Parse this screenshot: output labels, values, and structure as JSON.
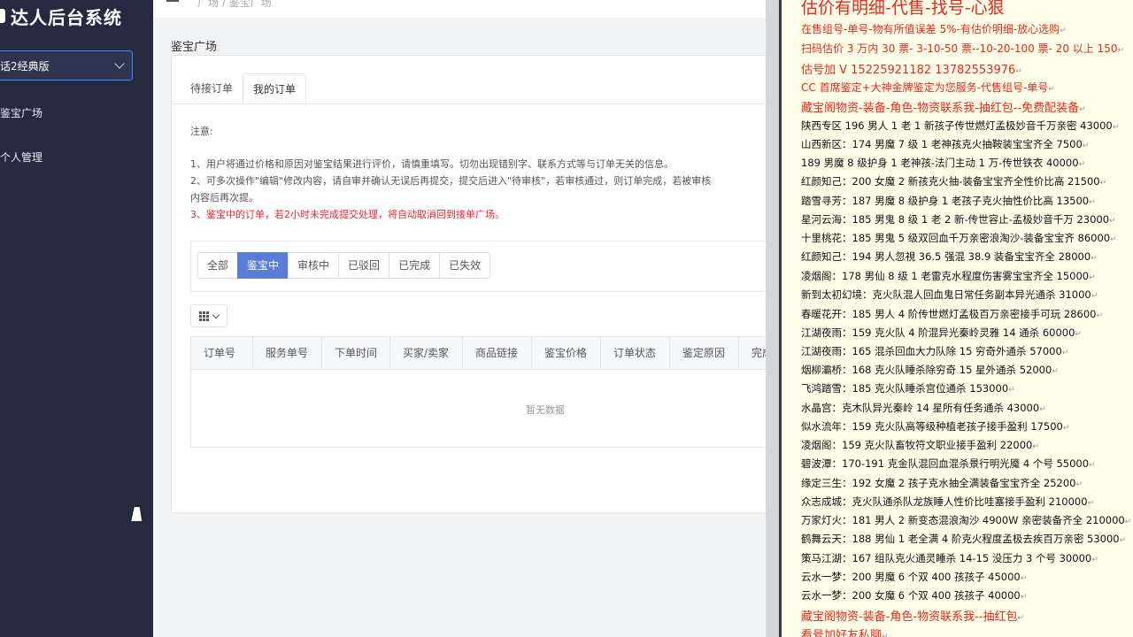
{
  "app": {
    "title": "达人后台系统"
  },
  "sidebar": {
    "game_select": "话2经典版",
    "items": [
      {
        "label": "鉴宝广场"
      },
      {
        "label": "个人管理"
      }
    ]
  },
  "header": {
    "breadcrumb": "广场 / 鉴宝广场"
  },
  "main": {
    "title": "鉴宝广场",
    "tabs": [
      {
        "label": "待接订单"
      },
      {
        "label": "我的订单"
      }
    ],
    "notice": {
      "heading": "注意:",
      "line1": "1、用户将通过价格和原因对鉴宝结果进行评价，请慎重填写。切勿出现错别字、联系方式等与订单无关的信息。",
      "line2a": "2、可多次操作\"编辑\"修改内容，请自审并确认无误后再提交，提交后进入\"待审核\"，若审核通过，则订单完成，若被审核",
      "line2b": "内容后再次提。",
      "line3": "3、鉴宝中的订单，若2小时未完成提交处理，将自动取消回到接单广场。"
    },
    "filters": [
      {
        "label": "全部"
      },
      {
        "label": "鉴宝中"
      },
      {
        "label": "审核中"
      },
      {
        "label": "已驳回"
      },
      {
        "label": "已完成"
      },
      {
        "label": "已失效"
      }
    ],
    "table": {
      "columns": [
        "订单号",
        "服务单号",
        "下单时间",
        "买家/卖家",
        "商品链接",
        "鉴宝价格",
        "订单状态",
        "鉴定原因",
        "完成"
      ],
      "empty_text": "暂无数据"
    }
  },
  "overlay": {
    "headline": "估价有明细-代售-找号-心狠",
    "lines": [
      {
        "text": "在售组号-单号-物有所值误差 5%-有估价明细-放心选购",
        "style": "red"
      },
      {
        "text": "扫码估价 3 万内 30 票- 3-10-50 票--10-20-100 票- 20 以上 150",
        "style": "red"
      },
      {
        "text": "估号加 V 15225921182    13782553976",
        "style": "red2"
      },
      {
        "text": "CC 首席鉴定+大神金牌鉴定为您服务-代售组号-单号",
        "style": "red"
      },
      {
        "text": "藏宝阁物资-装备-角色-物资联系我-抽红包--免费配装备",
        "style": "red2"
      },
      {
        "text": "陕西专区 196 男人 1 老 1 新孩子传世燃灯孟极妙音千万亲密 43000",
        "style": "black"
      },
      {
        "text": "山西新区：174 男魔 7 级 1 老神孩克火抽鞍装宝宝齐全 7500",
        "style": "black"
      },
      {
        "text": "189 男魔 8 级护身 1 老神孩-法门主动 1 万-传世铁衣 40000",
        "style": "black"
      },
      {
        "text": "红颜知己：200 女魔 2 新孩克火抽-装备宝宝齐全性价比高 21500",
        "style": "black"
      },
      {
        "text": "踏雪寻芳：187 男魔 8 级护身 1 老孩子克火抽性价比高 13500",
        "style": "black"
      },
      {
        "text": "星河云海：185 男鬼 8 级 1 老 2 新-传世容止-孟极妙音千万 23000",
        "style": "black"
      },
      {
        "text": "十里桃花：185 男鬼 5 级双回血千万亲密浪淘沙-装备宝宝齐 86000",
        "style": "black"
      },
      {
        "text": "红颜知己：194 男人忽視 36.5 强混 38.9 装备宝宝齐全 28000",
        "style": "black"
      },
      {
        "text": "凌烟阁：178 男仙 8 级 1 老雷克水程度伤害雾宝宝齐全 15000",
        "style": "black"
      },
      {
        "text": "新到太初幻境：克火队混人回血鬼日常任务副本异光通杀 31000",
        "style": "black"
      },
      {
        "text": "春暖花开：185 男人 4 阶传世燃灯孟极百万亲密接手可玩 28600",
        "style": "black"
      },
      {
        "text": "江湖夜雨：159 克火队 4 阶混异光秦岭灵雅 14 通杀 60000",
        "style": "black"
      },
      {
        "text": "江湖夜雨：165 混杀回血大力队除 15 穷奇外通杀 57000",
        "style": "black"
      },
      {
        "text": "烟柳灞桥：168 克火队睡杀除穷奇 15 星外通杀 52000",
        "style": "black"
      },
      {
        "text": "飞鸿踏雪：185 克火队睡杀宫位通杀 153000",
        "style": "black"
      },
      {
        "text": "水晶宫：克木队异光秦岭 14 星所有任务通杀 43000",
        "style": "black"
      },
      {
        "text": "似水流年：159 克火队高等级种植老孩子接手盈利 17500",
        "style": "black"
      },
      {
        "text": "凌烟阁：159 克火队畜牧符文职业接手盈利 22000",
        "style": "black"
      },
      {
        "text": "碧波潭：170-191 克金队混回血混杀景行明光魇 4 个号 55000",
        "style": "black"
      },
      {
        "text": "缘定三生：192 女魔 2 孩子克水抽全满装备宝宝齐全 25200",
        "style": "black"
      },
      {
        "text": "众志成城：克火队通杀队龙族睡人性价比哇塞接手盈利 210000",
        "style": "black"
      },
      {
        "text": "万家灯火：181 男人 2 新变态混浪淘沙 4900W 亲密装备齐全 210000",
        "style": "black"
      },
      {
        "text": "鹤舞云天：188 男仙 1 老全满 4 阶克火程度孟极去疾百万亲密 53000",
        "style": "black"
      },
      {
        "text": "策马江湖：167 组队克火通灵睡杀 14-15 没压力 3 个号 30000",
        "style": "black"
      },
      {
        "text": "云水一梦：200 男魔 6 个双 400 孩孩子 45000",
        "style": "black"
      },
      {
        "text": "云水一梦：200 女魔 6 个双 400 孩孩子 40000",
        "style": "black"
      },
      {
        "text": "藏宝阁物资-装备-角色-物资联系我--抽红包",
        "style": "red2"
      },
      {
        "text": "看号加好友私聊",
        "style": "red2"
      }
    ],
    "return_mark": "↵"
  }
}
